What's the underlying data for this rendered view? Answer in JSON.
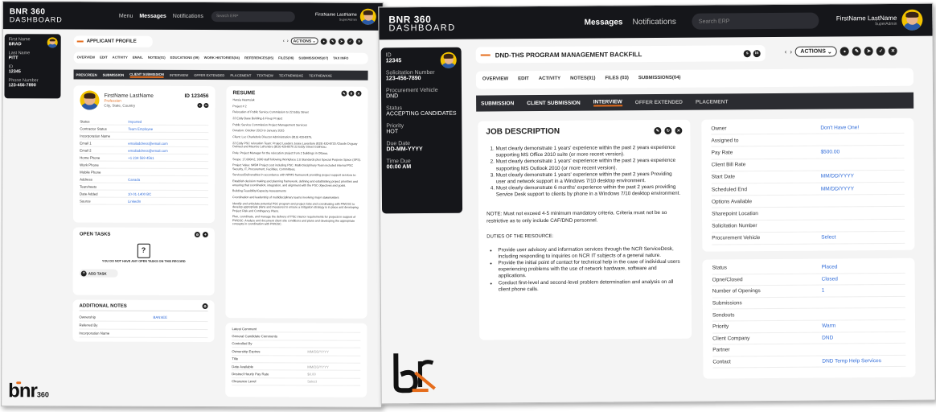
{
  "left": {
    "brand_line1": "BNR 360",
    "brand_line2": "DASHBOARD",
    "nav": [
      "Menu",
      "Messages",
      "Notifications"
    ],
    "search_placeholder": "Search ERP",
    "user_name": "FirstName LastName",
    "user_role": "SuperAdmin",
    "sidebar": [
      {
        "label": "First Name",
        "value": "BRAD"
      },
      {
        "label": "Last Name",
        "value": "PITT"
      },
      {
        "label": "ID",
        "value": "12345"
      },
      {
        "label": "Phone Number",
        "value": "123-456-7890"
      }
    ],
    "title": "APPLICANT PROFILE",
    "actions_label": "ACTIONS",
    "tabs": [
      "OVERVIEW",
      "EDIT",
      "ACTIVITY",
      "EMAIL",
      "NOTES(01)",
      "EDUCATIONS (09)",
      "WORK HISTORIES(04)",
      "REFERENCES(05)",
      "FILES(06)",
      "SUBMISSIONS(07)",
      "TAX INFO"
    ],
    "subtabs": [
      "PRESCREEN",
      "SUBMISSION",
      "CLIENT SUBMISSION",
      "INTERVIEW",
      "OFFER EXTENDED",
      "PLACEMENT",
      "TEXTNEW",
      "TEXTNEWIDXE",
      "TEXTNEWXXE"
    ],
    "profile_name": "FirstName LastName",
    "profile_role": "Profession",
    "profile_location": "City, State, Country",
    "profile_id": "ID 123456",
    "profile_fields": [
      {
        "k": "Status",
        "v": "Imported"
      },
      {
        "k": "Contractor Status",
        "v": "Team Employee"
      },
      {
        "k": "Incorporation Name",
        "v": ""
      },
      {
        "k": "Email 1",
        "v": "emailaddress@email.com"
      },
      {
        "k": "Email 2",
        "v": "emailaddress@email.com"
      },
      {
        "k": "Home Phone",
        "v": "+1 234 569 4561"
      },
      {
        "k": "Work Phone",
        "v": ""
      },
      {
        "k": "Mobile Phone",
        "v": ""
      },
      {
        "k": "Address",
        "v": "Canada"
      },
      {
        "k": "Tearsheets",
        "v": ""
      },
      {
        "k": "Date Added",
        "v": "10-01-1400 BC"
      },
      {
        "k": "Source",
        "v": "LinkedIn"
      }
    ],
    "open_tasks_title": "OPEN TASKS",
    "no_tasks": "YOU DO NOT HAVE ANY OPEN TASKS ON THIS RECORD",
    "add_task": "ADD TASK",
    "notes_title": "ADDITIONAL NOTES",
    "notes_fields": [
      {
        "k": "Ownership",
        "v": "BANSEE"
      },
      {
        "k": "Referred By",
        "v": ""
      },
      {
        "k": "Incorporation Name",
        "v": ""
      }
    ],
    "resume_title": "RESUME",
    "resume_lines": [
      "Harsia Hasmyiak",
      "Project # 2",
      "Relocation of Public Service Commission to 22 Eddy Street",
      "22 Eddy Base Building & Fit-up Project",
      "Public Service Commission Project Management Services",
      "Duration: October 2013 to January 2015",
      "Client: Luc Charlebois Director Administration (819) 420-8375,",
      "22 Eddy PSC relocation Team: Project Leaders Josée Lavardure (819) 420-8720 /Claude Duguay Delmed and Maurice Lafrenière (819) 420-8370 22 Eddy Street Gatineau.",
      "Role: Project Manager for the relocation project from 2 buildings in Ottawa.",
      "Scope: 17,000m2, 1000 staff following Workplace 2.0 Standards plus Special Purpose Space (SPS).",
      "Project Value: $45M Project cost including PSC. Multi-Disciplinary Team included internal PSC Security, IT, Procurement, Facilities, Committees,",
      "Services/Deliverables in accordance with NPMS framework providing project support services to:",
      "Establish decision making and planning framework, defining and establishing project priorities and ensuring that coordination, integration, and alignment with the PSC objectives and goals.",
      "Building Feasibility/Capacity Assessments",
      "Coordination and leadership of multidisciplinary teams involving major stakeholders",
      "Identify and articulate potential PSC program and project risks and coordinating with PWGSC to develop appropriate plans and measures to ensure a mitigation strategy is in place and developing Project Risk and Contingency Plans.",
      "Plan, coordinate, and manage the delivery of PSC interior requirements for projects in support of PWGSC. Analyze and document client site conditions and plans and developing the appropriate concepts in coordination with PWGSC."
    ],
    "bottom_fields": [
      {
        "k": "Latest Comment",
        "v": ""
      },
      {
        "k": "General Candidate Comments",
        "v": ""
      },
      {
        "k": "Controlled By",
        "v": ""
      },
      {
        "k": "Ownership Expires",
        "v": "MM/DD/YYYY"
      },
      {
        "k": "Title",
        "v": ""
      },
      {
        "k": "Date Available",
        "v": "MM/DD/YYYY"
      },
      {
        "k": "Desired Hourly Pay Rate",
        "v": "$0.00"
      },
      {
        "k": "Clearance Level",
        "v": "Select"
      }
    ],
    "logo_text": "bnr",
    "logo_sup": "360"
  },
  "right": {
    "brand_line1": "BNR 360",
    "brand_line2": "DASHBOARD",
    "nav": [
      "Messages",
      "Notifications"
    ],
    "search_placeholder": "Search ERP",
    "user_name": "FirstName LastName",
    "user_role": "SuperAdmin",
    "sidebar": [
      {
        "label": "ID",
        "value": "12345"
      },
      {
        "label": "Solicitation Number",
        "value": "123-456-7890"
      },
      {
        "label": "Procurement Vehicle",
        "value": "DND"
      },
      {
        "label": "Status",
        "value": "ACCEPTING CANDIDATES"
      },
      {
        "label": "Priority",
        "value": "HOT"
      },
      {
        "label": "Due Date",
        "value": "DD-MM-YYYY"
      },
      {
        "label": "Time Due",
        "value": "00:00 AM"
      }
    ],
    "title": "DND-THS PROGRAM MANAGEMENT BACKFILL",
    "actions_label": "ACTIONS",
    "tabs": [
      "OVERVIEW",
      "EDIT",
      "ACTIVITY",
      "NOTES(01)",
      "FILES (03)",
      "SUBMISSIONS(04)"
    ],
    "subtabs": [
      "SUBMISSION",
      "CLIENT SUBMISSION",
      "INTERVIEW",
      "OFFER EXTENDED",
      "PLACEMENT"
    ],
    "job_title": "JOB DESCRIPTION",
    "job_bullets": [
      "Must clearly demonstrate 1 years' experience within the past 2 years experience supporting MS Office 2010 suite (or more recent version).",
      "Must clearly demonstrate 1 years' experience within the past 2 years experience supporting MS Outlook 2010 (or more recent version).",
      "Must clearly demonstrate 1 years' experience within the past 2 years Providing user and network support in a Windows 7/10 desktop environment.",
      "Must clearly demonstrate 6 months' experience within the past 2 years providing Service Desk support to clients by phone in a Windows 7/10 desktop environment."
    ],
    "job_note": "NOTE: Must not exceed 4-5 minimum mandatory criteria. Criteria must not be so restrictive as to only include CAF/DND personnel.",
    "duties_title": "DUTIES OF THE RESOURCE:",
    "duties": [
      "Provide user advisory and information services through the NCR ServiceDesk, including responding to inquiries on NCR IT subjects of a general nature.",
      "Provide the initial point of contact for technical help in the case of individual users experiencing problems with the use of network hardware, software and applications.",
      "Conduct first-level and second-level problem determination and analysis on all client phone calls."
    ],
    "info1": [
      {
        "k": "Owner",
        "v": "Don't Have One!"
      },
      {
        "k": "Assigned to",
        "v": ""
      },
      {
        "k": "Pay Rate",
        "v": "$500.00"
      },
      {
        "k": "Client Bill Rate",
        "v": ""
      },
      {
        "k": "Start Date",
        "v": "MM/DD/YYYY"
      },
      {
        "k": "Scheduled End",
        "v": "MM/DD/YYYY"
      },
      {
        "k": "Options Available",
        "v": ""
      },
      {
        "k": "Sharepoint Location",
        "v": ""
      },
      {
        "k": "Solicitation Number",
        "v": ""
      },
      {
        "k": "Procurement Vehicle",
        "v": "Select"
      }
    ],
    "info2": [
      {
        "k": "Status",
        "v": "Placed"
      },
      {
        "k": "Opne/Closed",
        "v": "Closed"
      },
      {
        "k": "Number of Openings",
        "v": "1"
      },
      {
        "k": "Submissions",
        "v": ""
      },
      {
        "k": "Sendouts",
        "v": ""
      },
      {
        "k": "Priority",
        "v": "Warm"
      },
      {
        "k": "Client Company",
        "v": "DND"
      },
      {
        "k": "Partner",
        "v": ""
      },
      {
        "k": "Contact",
        "v": "DND Temp Help Services"
      }
    ]
  }
}
